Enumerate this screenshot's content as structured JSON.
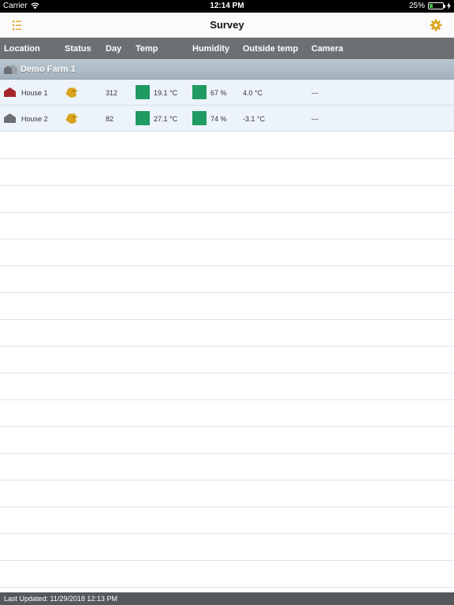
{
  "status_bar": {
    "carrier": "Carrier",
    "time": "12:14 PM",
    "battery": "25%",
    "battery_level": 0.25
  },
  "nav": {
    "title": "Survey",
    "menu_icon": "list-icon",
    "settings_icon": "gear-icon",
    "accent_color": "#d9a21c"
  },
  "table": {
    "columns": [
      "Location",
      "Status",
      "Day",
      "Temp",
      "Humidity",
      "Outside temp",
      "Camera"
    ],
    "group": {
      "label": "Demo Farm 1",
      "icon": "barn-icon"
    },
    "rows": [
      {
        "location": "House 1",
        "location_icon": "house-icon",
        "location_color": "#a4262c",
        "status_icon": "chicken-icon",
        "day": "312",
        "temp": "19.1 °C",
        "temp_color": "#1f9a63",
        "humidity": "67 %",
        "humidity_color": "#1f9a63",
        "outside_temp": "4.0 °C",
        "camera": "---"
      },
      {
        "location": "House 2",
        "location_icon": "house-icon",
        "location_color": "#6b6e72",
        "status_icon": "chicken-icon",
        "day": "82",
        "temp": "27.1 °C",
        "temp_color": "#1f9a63",
        "humidity": "74 %",
        "humidity_color": "#1f9a63",
        "outside_temp": "-3.1 °C",
        "camera": "---"
      }
    ]
  },
  "footer": {
    "last_updated": "Last Updated: 11/29/2018 12:13 PM"
  }
}
